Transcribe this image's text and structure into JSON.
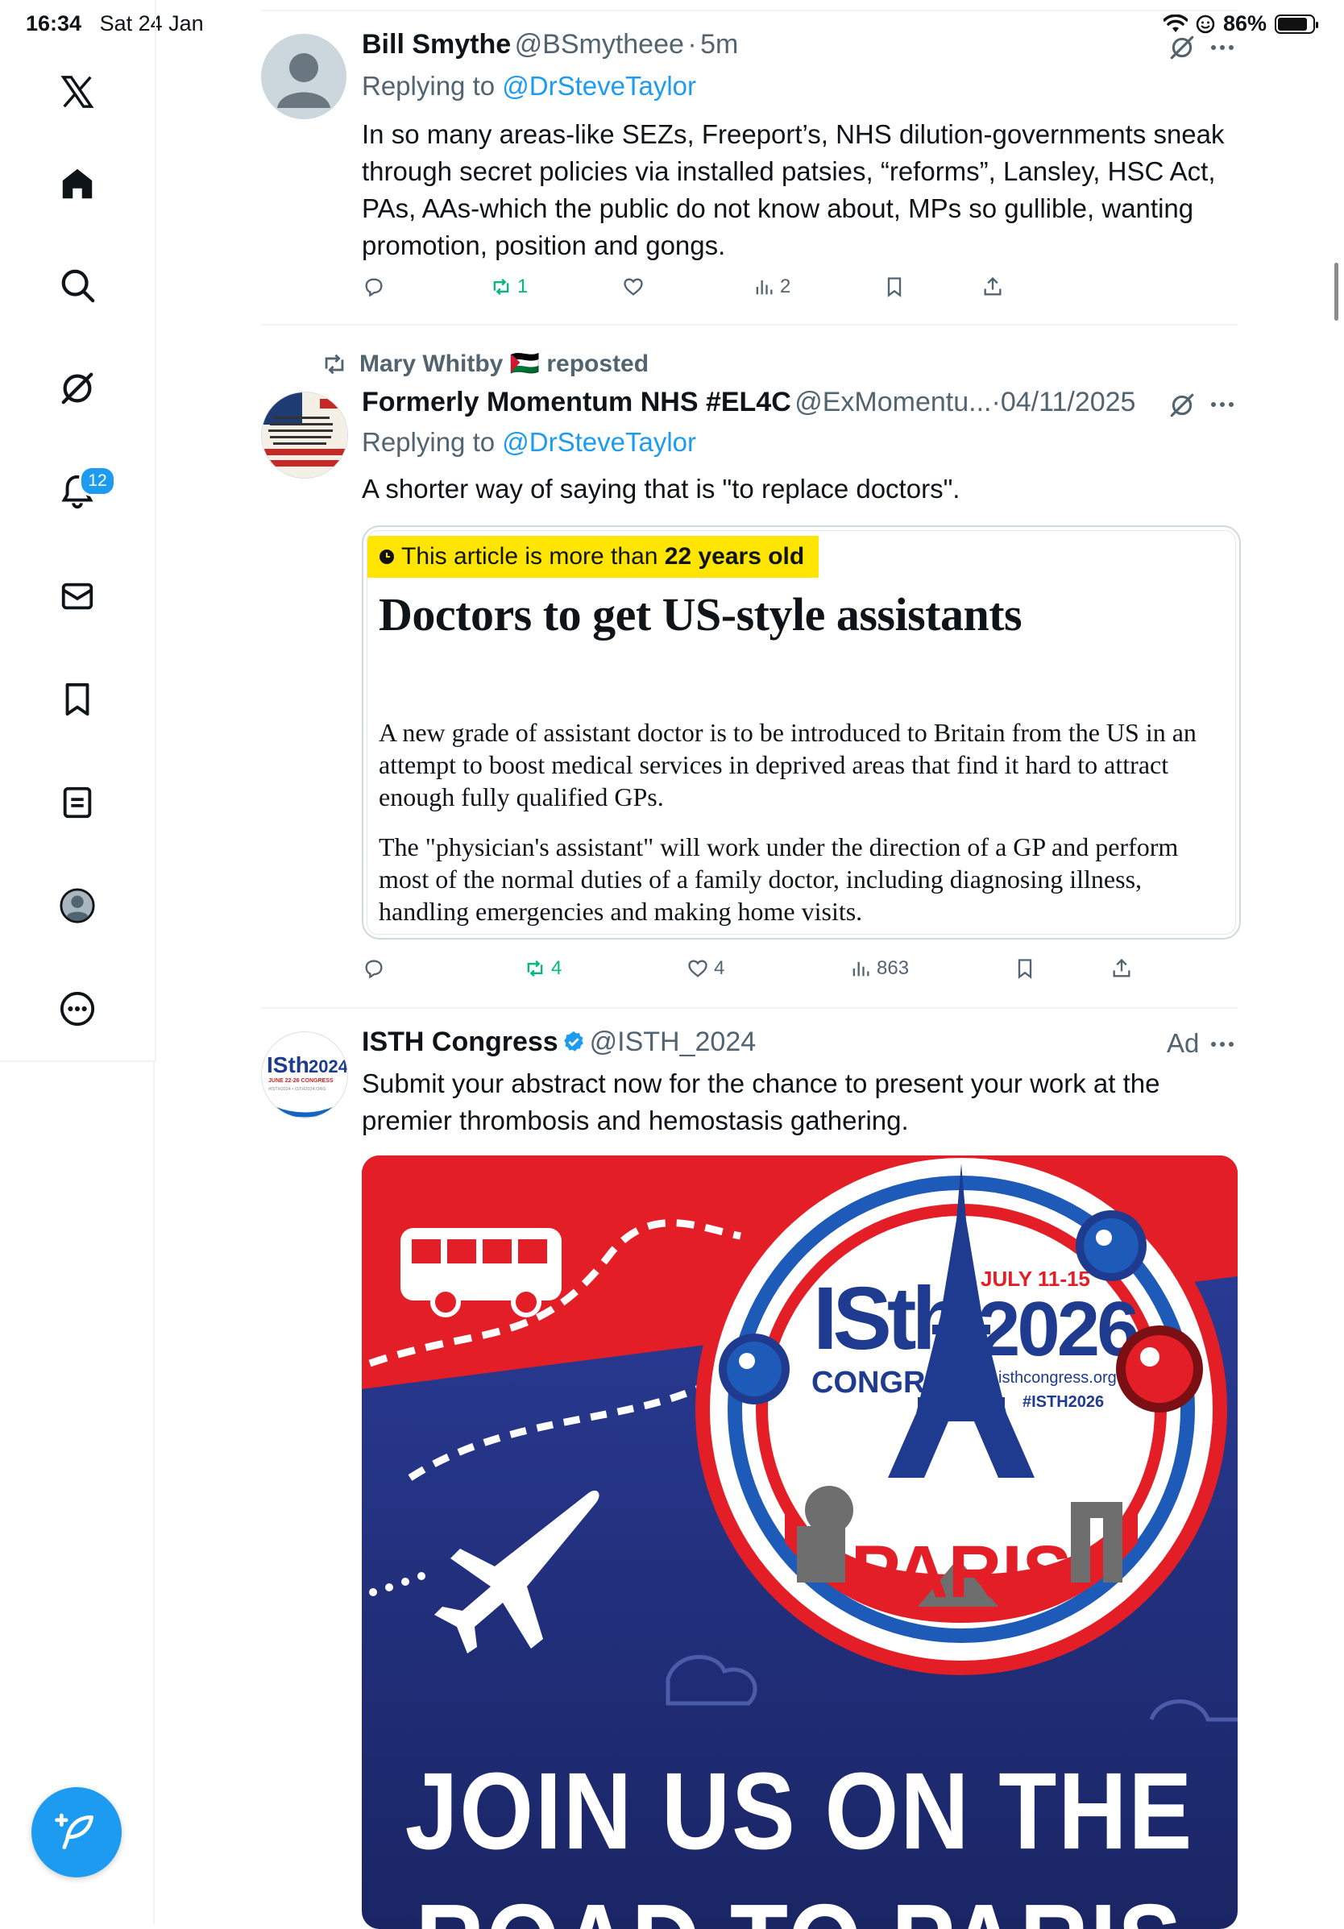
{
  "status_bar": {
    "time": "16:34",
    "date": "Sat 24 Jan",
    "battery": "86%",
    "battery_level": 0.86
  },
  "sidebar": {
    "items": [
      {
        "icon": "x-logo-icon"
      },
      {
        "icon": "home-icon"
      },
      {
        "icon": "search-icon"
      },
      {
        "icon": "grok-icon"
      },
      {
        "icon": "bell-icon"
      },
      {
        "icon": "mail-icon"
      },
      {
        "icon": "bookmark-icon"
      },
      {
        "icon": "lists-icon"
      },
      {
        "icon": "profile-icon"
      },
      {
        "icon": "more-icon"
      }
    ],
    "notification_count": "12"
  },
  "tweets": [
    {
      "name": "Bill Smythe",
      "handle": "@BSmytheee",
      "sep": "·",
      "time": "5m",
      "replying_prefix": "Replying to ",
      "replying_to": "@DrSteveTaylor",
      "text": "In so many areas-like SEZs, Freeport’s, NHS dilution-governments sneak through secret policies via installed patsies, “reforms”, Lansley, HSC Act, PAs, AAs-which the public do not know about, MPs so gullible, wanting promotion, position and gongs.",
      "retweets": "1",
      "likes": "",
      "views": "2"
    },
    {
      "repost_by": "Mary Whitby 🇵🇸 reposted",
      "name": "Formerly Momentum NHS #EL4C",
      "handle": "@ExMomentu...",
      "sep": "·",
      "time": "04/11/2025",
      "replying_prefix": "Replying to ",
      "replying_to": "@DrSteveTaylor",
      "text": "A shorter way of saying that is \"to replace doctors\".",
      "card": {
        "banner_prefix": "This article is more than ",
        "banner_bold": "22 years old",
        "headline": "Doctors to get US-style assistants",
        "para1": "A new grade of assistant doctor is to be introduced to Britain from the US in an attempt to boost medical services in deprived areas that find it hard to attract enough fully qualified GPs.",
        "para2": "The \"physician's assistant\" will work under the direction of a GP and perform most of the normal duties of a family doctor, including diagnosing illness, handling emergencies and making home visits."
      },
      "retweets": "4",
      "likes": "4",
      "views": "863"
    },
    {
      "name": "ISTH Congress",
      "handle": "@ISTH_2024",
      "ad_label": "Ad",
      "text": "Submit your abstract now for the chance to present your work at the premier thrombosis and hemostasis gathering.",
      "avatar_text": {
        "isth": "ISth",
        "year": "2024",
        "dates": "JUNE 22-26 CONGRESS",
        "tags": "#ISTH2024 • ISTH2024.ORG"
      },
      "ad_image": {
        "isth": "ISth",
        "congress": "CONGRESS",
        "dates": "JULY 11-15",
        "year": "2026",
        "site": "isthcongress.org",
        "tag": "#ISTH2026",
        "city": "PARIS",
        "line1": "JOIN US ON THE",
        "line2": "ROAD TO PARIS"
      }
    }
  ],
  "colors": {
    "accent": "#1d9bf0",
    "retweet_green": "#00ba7c",
    "muted": "#536471"
  }
}
